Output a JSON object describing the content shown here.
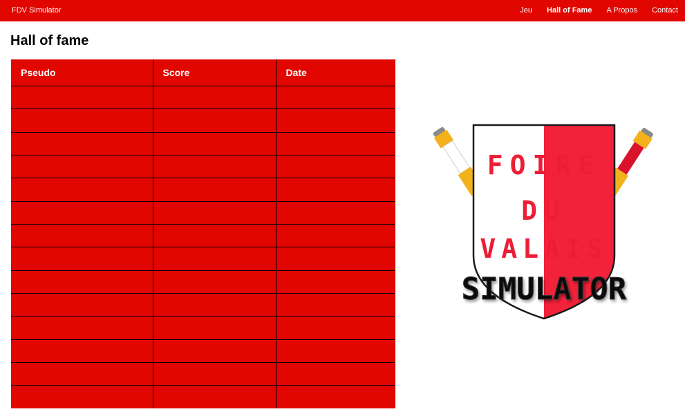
{
  "navbar": {
    "brand": "FDV Simulator",
    "links": [
      {
        "label": "Jeu",
        "active": false
      },
      {
        "label": "Hall of Fame",
        "active": true
      },
      {
        "label": "A Propos",
        "active": false
      },
      {
        "label": "Contact",
        "active": false
      }
    ]
  },
  "page": {
    "title": "Hall of fame"
  },
  "table": {
    "columns": [
      "Pseudo",
      "Score",
      "Date"
    ],
    "row_count": 14
  },
  "logo": {
    "line1": "FOIRE",
    "line2": "DU",
    "line3": "VALAIS",
    "line4": "SIMULATOR"
  },
  "colors": {
    "accent": "#e10600",
    "shield_red": "#f2223a",
    "shield_white": "#ffffff"
  }
}
